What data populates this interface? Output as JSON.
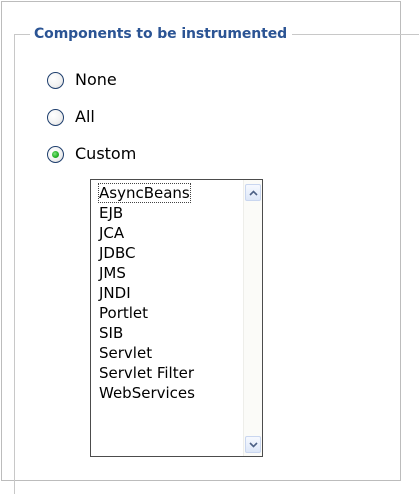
{
  "fieldset": {
    "legend": "Components to be instrumented"
  },
  "options": [
    {
      "label": "None",
      "checked": false
    },
    {
      "label": "All",
      "checked": false
    },
    {
      "label": "Custom",
      "checked": true
    }
  ],
  "components_list": {
    "items": [
      "AsyncBeans",
      "EJB",
      "JCA",
      "JDBC",
      "JMS",
      "JNDI",
      "Portlet",
      "SIB",
      "Servlet",
      "Servlet Filter",
      "WebServices"
    ],
    "focused_index": 0
  },
  "icons": {
    "scroll_up": "chevron-up-icon",
    "scroll_down": "chevron-down-icon"
  }
}
